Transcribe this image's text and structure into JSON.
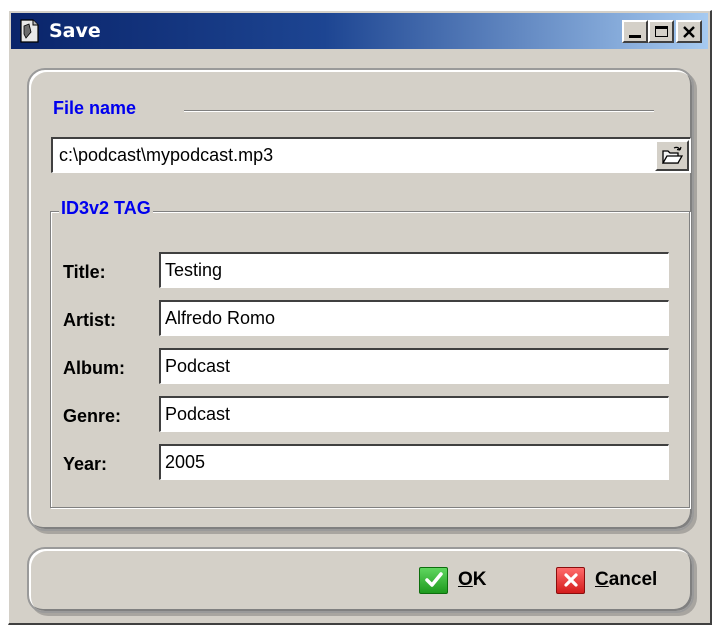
{
  "window": {
    "title": "Save"
  },
  "file": {
    "section_label": "File name",
    "path_value": "c:\\podcast\\mypodcast.mp3"
  },
  "id3": {
    "group_label": "ID3v2 TAG",
    "fields": [
      {
        "label": "Title:",
        "value": "Testing"
      },
      {
        "label": "Artist:",
        "value": "Alfredo Romo"
      },
      {
        "label": "Album:",
        "value": "Podcast"
      },
      {
        "label": "Genre:",
        "value": "Podcast"
      },
      {
        "label": "Year:",
        "value": "2005"
      }
    ]
  },
  "buttons": {
    "ok_mnemonic": "O",
    "ok_rest": "K",
    "cancel_mnemonic": "C",
    "cancel_rest": "ancel"
  },
  "colors": {
    "title_bar_start": "#0a246a",
    "title_bar_end": "#a6caf0",
    "section_label": "#0000ee",
    "ok_icon": "#2db52d",
    "cancel_icon": "#e02a2a"
  },
  "icons": {
    "app": "document-icon",
    "browse": "open-folder-icon",
    "ok": "checkmark-icon",
    "cancel": "x-icon"
  }
}
